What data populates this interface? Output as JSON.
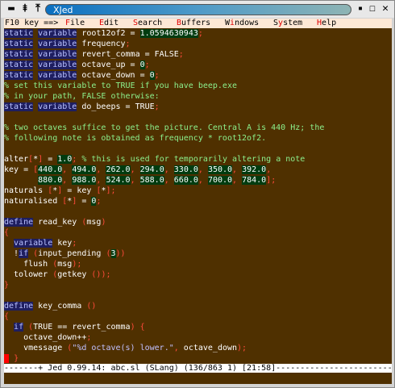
{
  "window": {
    "title": "XJed",
    "buttons": {
      "minimize": "▬",
      "pin": "⯒",
      "stick": "⤒",
      "shade": "▪",
      "maximize": "☐",
      "close": "✕"
    }
  },
  "menubar": {
    "prefix": "F10 key ==>",
    "items": [
      {
        "hot": "F",
        "rest": "ile"
      },
      {
        "hot": "E",
        "rest": "dit"
      },
      {
        "hot": "S",
        "rest": "earch"
      },
      {
        "hot": "B",
        "rest": "uffers"
      },
      {
        "pre": "W",
        "hot": "i",
        "rest": "ndows"
      },
      {
        "pre": "S",
        "hot": "y",
        "rest": "stem"
      },
      {
        "hot": "H",
        "rest": "elp"
      }
    ]
  },
  "colors": {
    "background": "#4f3000",
    "keyword_bg": "#1e1e60",
    "number_bg": "#003c10",
    "comment": "#8cf08c",
    "delimiter": "#ff4a3a",
    "string": "#c0c0ff"
  },
  "lines": [
    [
      [
        "k",
        "static"
      ],
      [
        "t",
        " "
      ],
      [
        "k",
        "variable"
      ],
      [
        "t",
        " root12of2 = "
      ],
      [
        "n",
        "1.0594630943"
      ],
      [
        "d",
        ";"
      ]
    ],
    [
      [
        "k",
        "static"
      ],
      [
        "t",
        " "
      ],
      [
        "k",
        "variable"
      ],
      [
        "t",
        " frequency"
      ],
      [
        "d",
        ";"
      ]
    ],
    [
      [
        "k",
        "static"
      ],
      [
        "t",
        " "
      ],
      [
        "k",
        "variable"
      ],
      [
        "t",
        " revert_comma = FALSE"
      ],
      [
        "d",
        ";"
      ]
    ],
    [
      [
        "k",
        "static"
      ],
      [
        "t",
        " "
      ],
      [
        "k",
        "variable"
      ],
      [
        "t",
        " octave_up = "
      ],
      [
        "n",
        "0"
      ],
      [
        "d",
        ";"
      ]
    ],
    [
      [
        "k",
        "static"
      ],
      [
        "t",
        " "
      ],
      [
        "k",
        "variable"
      ],
      [
        "t",
        " octave_down = "
      ],
      [
        "n",
        "0"
      ],
      [
        "d",
        ";"
      ]
    ],
    [
      [
        "c",
        "% set this variable to TRUE if you have beep.exe"
      ]
    ],
    [
      [
        "c",
        "% in your path, FALSE otherwise:"
      ]
    ],
    [
      [
        "k",
        "static"
      ],
      [
        "t",
        " "
      ],
      [
        "k",
        "variable"
      ],
      [
        "t",
        " do_beeps = TRUE"
      ],
      [
        "d",
        ";"
      ]
    ],
    [],
    [
      [
        "c",
        "% two octaves suffice to get the picture. Central A is 440 Hz; the"
      ]
    ],
    [
      [
        "c",
        "% following note is obtained as frequency * root12of2."
      ]
    ],
    [],
    [
      [
        "t",
        "alter"
      ],
      [
        "d",
        "["
      ],
      [
        "t",
        "*"
      ],
      [
        "d",
        "]"
      ],
      [
        "t",
        " = "
      ],
      [
        "n",
        "1.0"
      ],
      [
        "d",
        ";"
      ],
      [
        "c",
        " % this is used for temporarily altering a note"
      ]
    ],
    [
      [
        "t",
        "key = "
      ],
      [
        "d",
        "["
      ],
      [
        "n",
        "440.0"
      ],
      [
        "d",
        ", "
      ],
      [
        "n",
        "494.0"
      ],
      [
        "d",
        ", "
      ],
      [
        "n",
        "262.0"
      ],
      [
        "d",
        ", "
      ],
      [
        "n",
        "294.0"
      ],
      [
        "d",
        ", "
      ],
      [
        "n",
        "330.0"
      ],
      [
        "d",
        ", "
      ],
      [
        "n",
        "350.0"
      ],
      [
        "d",
        ", "
      ],
      [
        "n",
        "392.0"
      ],
      [
        "d",
        ","
      ]
    ],
    [
      [
        "t",
        "       "
      ],
      [
        "n",
        "880.0"
      ],
      [
        "d",
        ", "
      ],
      [
        "n",
        "988.0"
      ],
      [
        "d",
        ", "
      ],
      [
        "n",
        "524.0"
      ],
      [
        "d",
        ", "
      ],
      [
        "n",
        "588.0"
      ],
      [
        "d",
        ", "
      ],
      [
        "n",
        "660.0"
      ],
      [
        "d",
        ", "
      ],
      [
        "n",
        "700.0"
      ],
      [
        "d",
        ", "
      ],
      [
        "n",
        "784.0"
      ],
      [
        "d",
        "];"
      ]
    ],
    [
      [
        "t",
        "naturals "
      ],
      [
        "d",
        "["
      ],
      [
        "t",
        "*"
      ],
      [
        "d",
        "]"
      ],
      [
        "t",
        " = key "
      ],
      [
        "d",
        "["
      ],
      [
        "t",
        "*"
      ],
      [
        "d",
        "];"
      ]
    ],
    [
      [
        "t",
        "naturalised "
      ],
      [
        "d",
        "["
      ],
      [
        "t",
        "*"
      ],
      [
        "d",
        "]"
      ],
      [
        "t",
        " = "
      ],
      [
        "n",
        "0"
      ],
      [
        "d",
        ";"
      ]
    ],
    [],
    [
      [
        "k",
        "define"
      ],
      [
        "t",
        " read_key "
      ],
      [
        "d",
        "("
      ],
      [
        "t",
        "msg"
      ],
      [
        "d",
        ")"
      ]
    ],
    [
      [
        "d",
        "{"
      ]
    ],
    [
      [
        "t",
        "  "
      ],
      [
        "k",
        "variable"
      ],
      [
        "t",
        " key"
      ],
      [
        "d",
        ";"
      ]
    ],
    [
      [
        "t",
        "  !"
      ],
      [
        "k",
        "if"
      ],
      [
        "t",
        " "
      ],
      [
        "d",
        "("
      ],
      [
        "t",
        "input_pending "
      ],
      [
        "d",
        "("
      ],
      [
        "n",
        "3"
      ],
      [
        "d",
        "))"
      ]
    ],
    [
      [
        "t",
        "    flush "
      ],
      [
        "d",
        "("
      ],
      [
        "t",
        "msg"
      ],
      [
        "d",
        ");"
      ]
    ],
    [
      [
        "t",
        "  tolower "
      ],
      [
        "d",
        "("
      ],
      [
        "t",
        "getkey "
      ],
      [
        "d",
        "());"
      ]
    ],
    [
      [
        "d",
        "}"
      ]
    ],
    [],
    [
      [
        "k",
        "define"
      ],
      [
        "t",
        " key_comma "
      ],
      [
        "d",
        "()"
      ]
    ],
    [
      [
        "d",
        "{"
      ]
    ],
    [
      [
        "t",
        "  "
      ],
      [
        "k",
        "if"
      ],
      [
        "t",
        " "
      ],
      [
        "d",
        "("
      ],
      [
        "t",
        "TRUE == revert_comma"
      ],
      [
        "d",
        ")"
      ],
      [
        "t",
        " "
      ],
      [
        "d",
        "{"
      ]
    ],
    [
      [
        "t",
        "    octave_down++"
      ],
      [
        "d",
        ";"
      ]
    ],
    [
      [
        "t",
        "    vmessage "
      ],
      [
        "d",
        "("
      ],
      [
        "s",
        "\"%d octave(s) lower.\""
      ],
      [
        "d",
        ", "
      ],
      [
        "t",
        "octave_down"
      ],
      [
        "d",
        ");"
      ]
    ],
    [
      [
        "cur",
        " "
      ],
      [
        "t",
        " "
      ],
      [
        "d",
        "}"
      ]
    ]
  ],
  "status": "-------+ Jed 0.99.14: abc.sl (SLang) (136/863 1) [21:58]------------------------------------"
}
